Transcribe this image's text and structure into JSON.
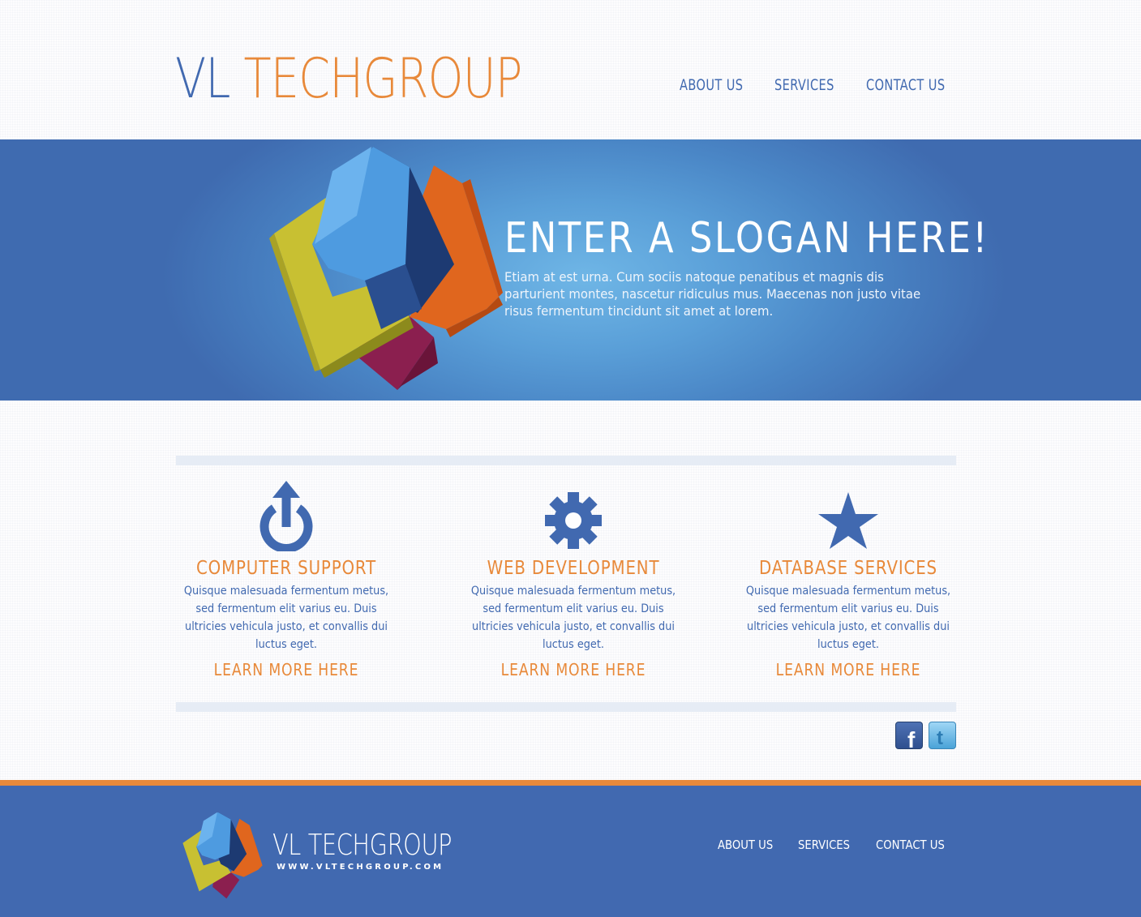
{
  "brand": {
    "name_part1": "VL",
    "name_part2": "TECHGROUP"
  },
  "nav": {
    "items": [
      "ABOUT US",
      "SERVICES",
      "CONTACT US"
    ]
  },
  "hero": {
    "slogan": "ENTER A SLOGAN HERE!",
    "text": "Etiam at est urna. Cum sociis natoque penatibus et magnis dis parturient montes, nascetur ridiculus mus. Maecenas non justo vitae risus fermentum tincidunt sit amet at lorem."
  },
  "services": [
    {
      "icon": "power-upload-icon",
      "title": "COMPUTER SUPPORT",
      "text": "Quisque malesuada fermentum metus, sed fermentum elit varius eu. Duis ultricies vehicula justo, et convallis dui luctus eget.",
      "link": "LEARN MORE HERE"
    },
    {
      "icon": "gear-icon",
      "title": "WEB DEVELOPMENT",
      "text": "Quisque malesuada fermentum metus, sed fermentum elit varius eu. Duis ultricies vehicula justo, et convallis dui luctus eget.",
      "link": "LEARN MORE HERE"
    },
    {
      "icon": "star-icon",
      "title": "DATABASE SERVICES",
      "text": "Quisque malesuada fermentum metus, sed fermentum elit varius eu. Duis ultricies vehicula justo, et convallis dui luctus eget.",
      "link": "LEARN MORE HERE"
    }
  ],
  "social": [
    {
      "icon": "facebook-icon",
      "glyph": "f",
      "color": "#3b5b9a"
    },
    {
      "icon": "twitter-icon",
      "glyph": "t",
      "color": "#4aa3d8"
    }
  ],
  "footer": {
    "brand_name": "VL TECHGROUP",
    "url": "WWW.VLTECHGROUP.COM",
    "nav": [
      "ABOUT US",
      "SERVICES",
      "CONTACT US"
    ]
  },
  "colors": {
    "primary_blue": "#4169b0",
    "accent_orange": "#e8893a"
  }
}
